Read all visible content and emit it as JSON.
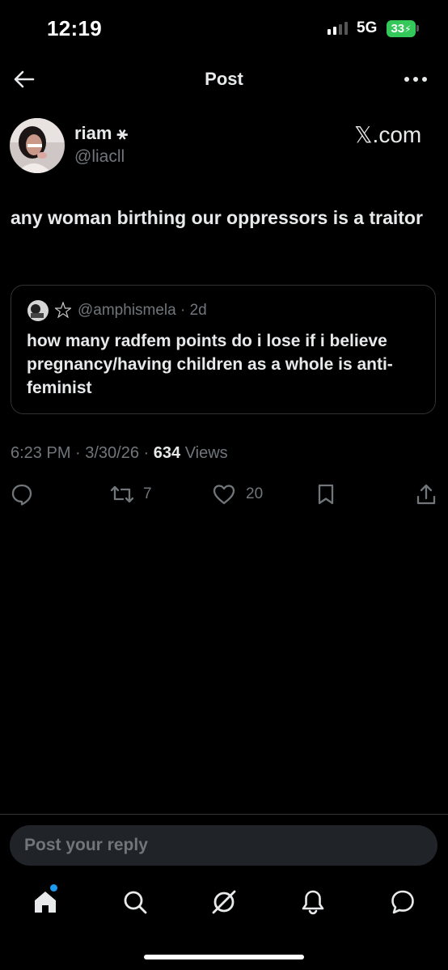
{
  "status_bar": {
    "time": "12:19",
    "network": "5G",
    "battery": "33",
    "colors": {
      "battery": "#34c759"
    }
  },
  "header": {
    "title": "Post",
    "back_icon": "arrow-left-icon",
    "more_icon": "more-horizontal-icon"
  },
  "post": {
    "author_name": "riam",
    "author_symbol": "⚹",
    "author_handle": "@liacll",
    "source_label": "𝕏.com",
    "text": "any woman birthing our oppressors is a traitor",
    "quoted": {
      "handle_meta": "@amphismela · 2d",
      "text": "how many radfem points do i lose if i believe pregnancy/having children as a whole is anti-feminist"
    },
    "time": "6:23 PM · 3/30/26 · ",
    "views_count": "634",
    "views_label": " Views",
    "actions": {
      "reposts": "7",
      "likes": "20"
    }
  },
  "reply": {
    "placeholder": "Post your reply"
  },
  "bottom_nav": {
    "items": [
      "home-icon",
      "search-icon",
      "grok-icon",
      "notifications-icon",
      "messages-icon"
    ],
    "accent": "#1d9bf0"
  }
}
